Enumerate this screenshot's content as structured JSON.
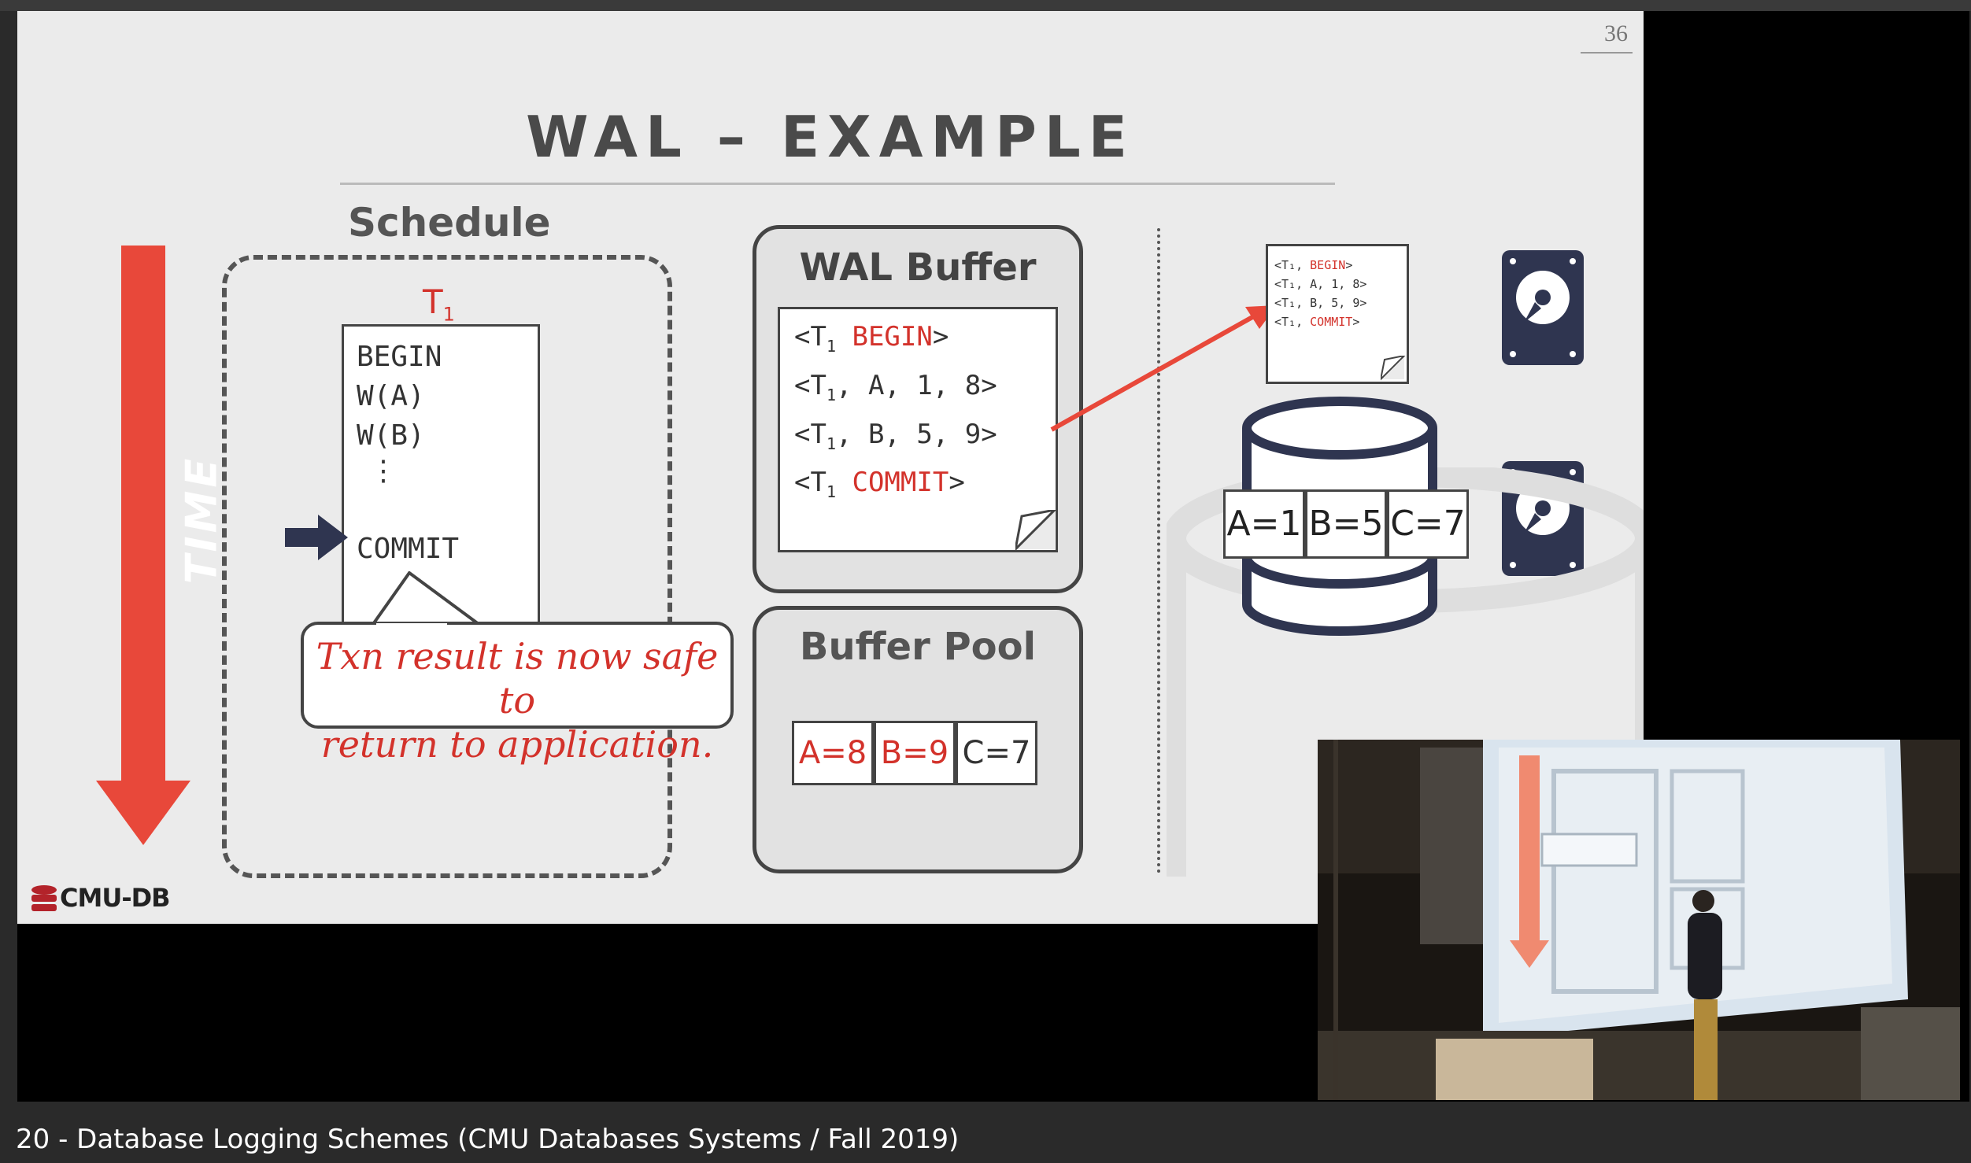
{
  "page_number": "36",
  "slide_title": "WAL – EXAMPLE",
  "schedule": {
    "label": "Schedule",
    "txn": "T",
    "txn_sub": "1",
    "ops": [
      "BEGIN",
      "W(A)",
      "W(B)",
      "⋮"
    ],
    "commit": "COMMIT"
  },
  "time_label": "TIME",
  "callout": {
    "line1": "Txn result is now safe to",
    "line2": "return to application."
  },
  "wal_buffer": {
    "label": "WAL Buffer",
    "entries": [
      {
        "pre": "<T",
        "sub": "1",
        "mid": " ",
        "red": "BEGIN",
        "post": ">"
      },
      {
        "pre": "<T",
        "sub": "1",
        "mid": ", A, 1, 8>",
        "red": "",
        "post": ""
      },
      {
        "pre": "<T",
        "sub": "1",
        "mid": ", B, 5, 9>",
        "red": "",
        "post": ""
      },
      {
        "pre": "<T",
        "sub": "1",
        "mid": " ",
        "red": "COMMIT",
        "post": ">"
      }
    ]
  },
  "buffer_pool": {
    "label": "Buffer Pool",
    "cells": [
      "A=8",
      "B=9",
      "C=7"
    ],
    "cell_colors": [
      "#d3322b",
      "#d3322b",
      "#333333"
    ]
  },
  "disk_log": {
    "lines": [
      {
        "pre": "<T₁, ",
        "red": "BEGIN",
        "post": ">"
      },
      {
        "pre": "<T₁, A, 1, 8>",
        "red": "",
        "post": ""
      },
      {
        "pre": "<T₁, B, 5, 9>",
        "red": "",
        "post": ""
      },
      {
        "pre": "<T₁, ",
        "red": "COMMIT",
        "post": ">"
      }
    ]
  },
  "disk_db": {
    "cells": [
      "A=1",
      "B=5",
      "C=7"
    ]
  },
  "logo": "CMU-DB",
  "caption": "20 - Database Logging Schemes (CMU Databases Systems / Fall 2019)",
  "colors": {
    "accent_red": "#d3322b",
    "slide_bg": "#ebebeb",
    "dark_navy": "#2f3550"
  },
  "icons": [
    "hard-disk-icon",
    "database-icon",
    "arrow-right-icon",
    "time-arrow-icon",
    "cmu-db-logo-icon"
  ]
}
